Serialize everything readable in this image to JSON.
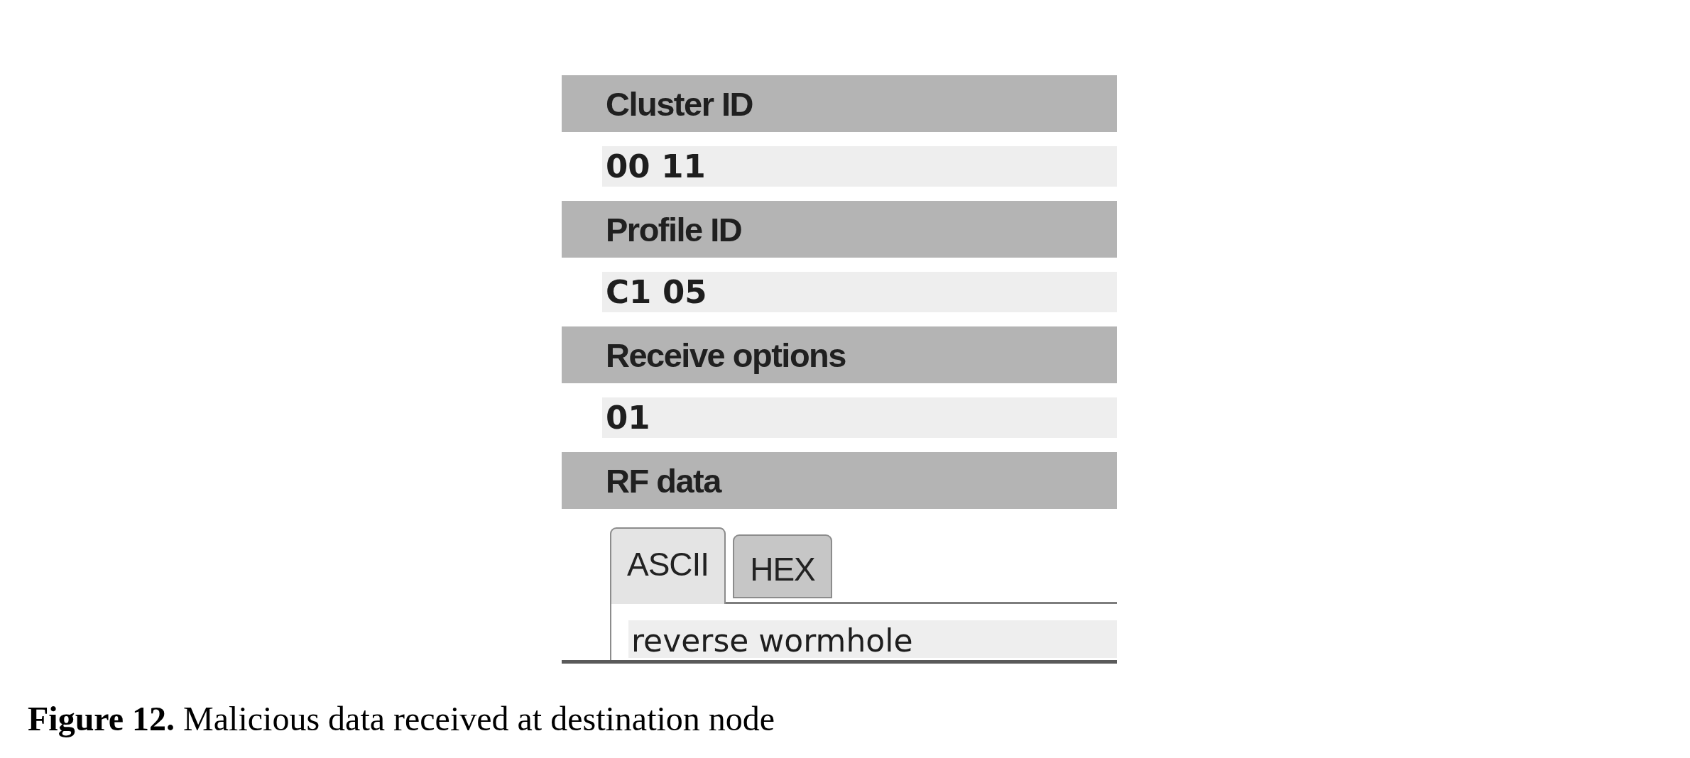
{
  "fields": [
    {
      "label": "Cluster ID",
      "value": "00 11"
    },
    {
      "label": "Profile ID",
      "value": "C1 05"
    },
    {
      "label": "Receive options",
      "value": "01"
    }
  ],
  "rf_data": {
    "label": "RF data",
    "tabs": [
      {
        "label": "ASCII",
        "selected": true
      },
      {
        "label": "HEX",
        "selected": false
      }
    ],
    "value": "reverse wormhole"
  },
  "caption": "**Figure 12.** Malicious data received at destination node"
}
